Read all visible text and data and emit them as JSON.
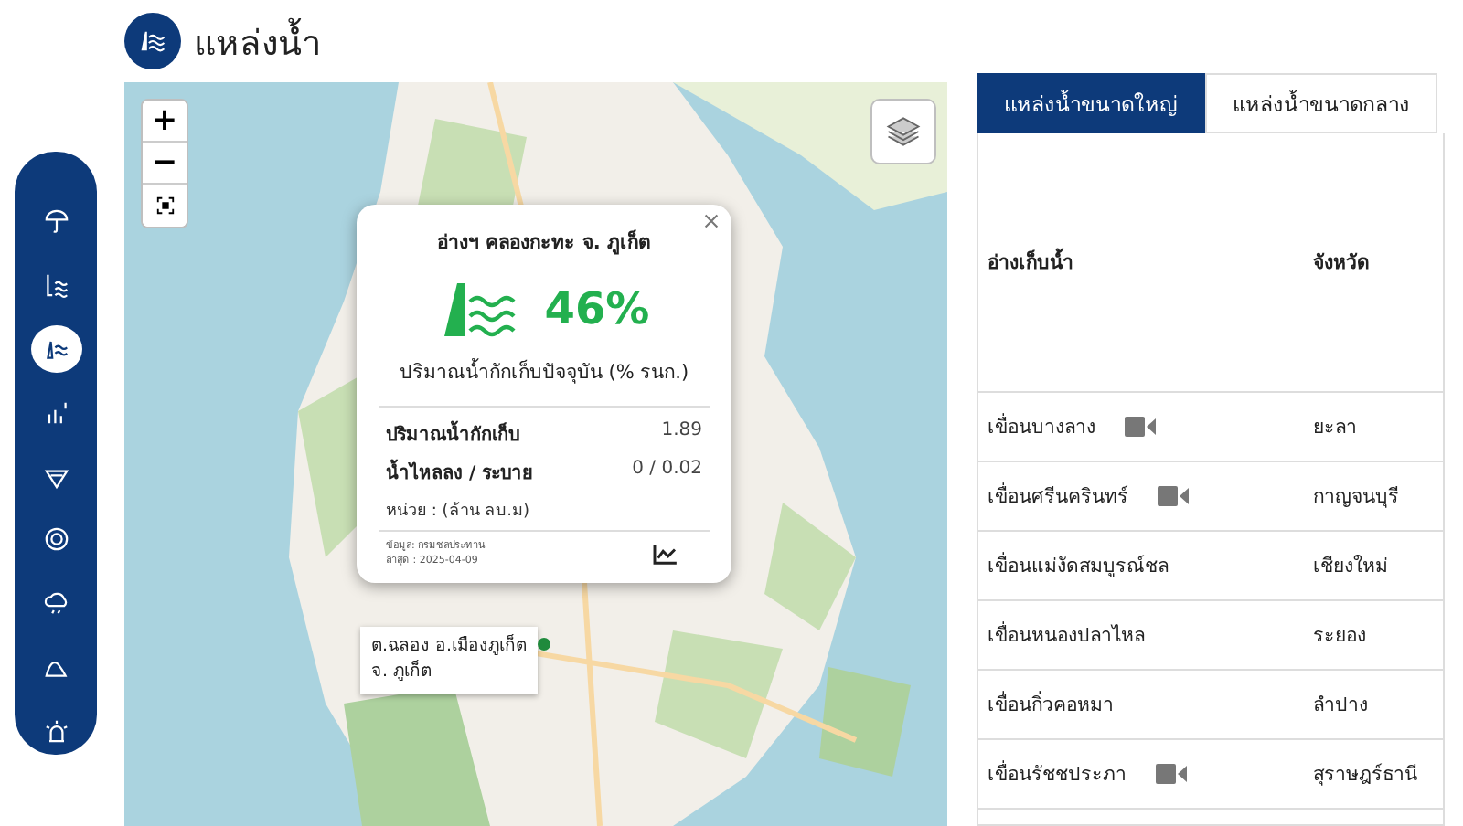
{
  "page": {
    "title": "แหล่งน้ำ"
  },
  "sidebar": {
    "items": [
      {
        "selected": false
      },
      {
        "selected": false
      },
      {
        "selected": true
      },
      {
        "selected": false
      },
      {
        "selected": false
      },
      {
        "selected": false
      },
      {
        "selected": false
      },
      {
        "selected": false
      },
      {
        "selected": false
      }
    ]
  },
  "map": {
    "zoom_in": "+",
    "zoom_out": "−",
    "popup": {
      "title": "อ่างฯ คลองกะทะ จ. ภูเก็ต",
      "percent": "46%",
      "subtitle": "ปริมาณน้ำกักเก็บปัจจุบัน (% รนก.)",
      "rows": [
        {
          "label": "ปริมาณน้ำกักเก็บ",
          "value": "1.89"
        },
        {
          "label": "น้ำไหลลง / ระบาย",
          "value": "0 / 0.02"
        }
      ],
      "unit": "หน่วย : (ล้าน ลบ.ม)",
      "source": "ข้อมูล: กรมชลประทาน",
      "updated": "ล่าสุด : 2025-04-09"
    },
    "location_label": [
      "ต.ฉลอง อ.เมืองภูเก็ต",
      "จ. ภูเก็ต"
    ]
  },
  "tabs": [
    {
      "label": "แหล่งน้ำขนาดใหญ่",
      "selected": true
    },
    {
      "label": "แหล่งน้ำขนาดกลาง",
      "selected": false
    }
  ],
  "table": {
    "columns": [
      "อ่างเก็บน้ำ",
      "จังหวัด"
    ],
    "rows": [
      {
        "name": "เขื่อนบางลาง",
        "camera": true,
        "province": "ยะลา"
      },
      {
        "name": "เขื่อนศรีนครินทร์",
        "camera": true,
        "province": "กาญจนบุรี"
      },
      {
        "name": "เขื่อนแม่งัดสมบูรณ์ชล",
        "camera": false,
        "province": "เชียงใหม่"
      },
      {
        "name": "เขื่อนหนองปลาไหล",
        "camera": false,
        "province": "ระยอง"
      },
      {
        "name": "เขื่อนกิ่วคอหมา",
        "camera": false,
        "province": "ลำปาง"
      },
      {
        "name": "เขื่อนรัชชประภา",
        "camera": true,
        "province": "สุราษฎร์ธานี"
      }
    ]
  }
}
